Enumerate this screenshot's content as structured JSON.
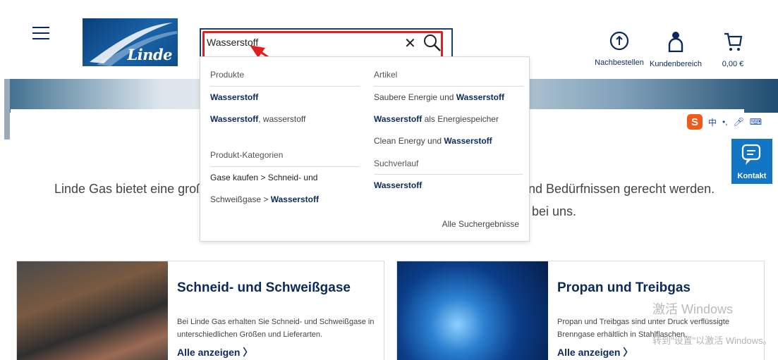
{
  "header": {
    "logo_text": "Linde",
    "search": {
      "value": "Wasserstoff",
      "placeholder": ""
    },
    "actions": [
      {
        "label": "Nachbestellen"
      },
      {
        "label": "Kundenbereich"
      },
      {
        "label": "0,00 €"
      }
    ]
  },
  "dropdown": {
    "products": {
      "heading": "Produkte",
      "items": [
        {
          "bold": "Wasserstoff",
          "rest": ""
        },
        {
          "bold": "Wasserstoff",
          "rest": ", wasserstoff"
        }
      ]
    },
    "categories": {
      "heading": "Produkt-Kategorien",
      "line1": "Gase kaufen > Schneid- und",
      "line2_prefix": "Schweißgase > ",
      "line2_bold": "Wasserstoff"
    },
    "articles": {
      "heading": "Artikel",
      "items": [
        {
          "prefix": "Saubere Energie und ",
          "bold": "Wasserstoff",
          "suffix": ""
        },
        {
          "prefix": "",
          "bold": "Wasserstoff",
          "suffix": " als Energiespeicher"
        },
        {
          "prefix": "Clean Energy und ",
          "bold": "Wasserstoff",
          "suffix": ""
        }
      ]
    },
    "history": {
      "heading": "Suchverlauf",
      "items": [
        {
          "bold": "Wasserstoff"
        }
      ]
    },
    "all_results": "Alle Suchergebnisse"
  },
  "ime": {
    "logo": "S",
    "mode": "中",
    "punct": "•,"
  },
  "kontakt": {
    "label": "Kontakt"
  },
  "intro": {
    "line1_left": "Linde Gas bietet eine groß",
    "line1_right": "und Bedürfnissen gerecht werden.",
    "line2_right": "e bei uns."
  },
  "cards": [
    {
      "title": "Schneid- und Schweißgase",
      "text": "Bei Linde Gas erhalten Sie Schneid- und Schweißgase in unterschiedlichen Größen und Lieferarten.",
      "link": "Alle anzeigen  〉"
    },
    {
      "title": "Propan und Treibgas",
      "text": "Propan und Treibgas sind unter Druck verflüssigte Brenngase erhältlich in Stahlflaschen.",
      "link": "Alle anzeigen  〉"
    }
  ],
  "watermark": {
    "line1": "激活 Windows",
    "line2": "转到\"设置\"以激活 Windows。"
  },
  "colors": {
    "brand_navy": "#0b2a5c",
    "kontakt_blue": "#1276c4",
    "annotation_red": "#e02020"
  }
}
